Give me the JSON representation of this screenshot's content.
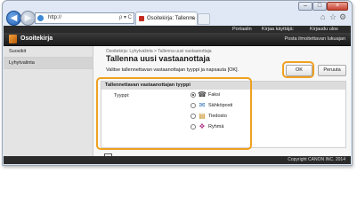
{
  "browser": {
    "url": "http://",
    "address_controls": "ρ ▾ C",
    "tab_title": "Osoitekirja: Tallenna ...",
    "tab_close": "×",
    "window_controls": {
      "minimize": "–",
      "maximize": "□",
      "close": "×"
    },
    "toolbar_icons": [
      "home-icon",
      "star-icon",
      "gear-icon"
    ]
  },
  "topbar": {
    "links": [
      "Portaalin",
      "Kirjaa käyttäjä:",
      "Kirjaudu ulos"
    ]
  },
  "header": {
    "app_title": "Osoitekirja",
    "right_link": "Posta ilmoitettavan lukuajan"
  },
  "sidebar": {
    "items": [
      {
        "label": "Suosikit"
      },
      {
        "label": "Lyhytvalinta"
      }
    ]
  },
  "main": {
    "breadcrumb": "Osoitekirja: Lyhytvalinta > Tallenna uusi vastaanottaja",
    "title": "Tallenna uusi vastaanottaja",
    "instruction": "Valitse tallennettavan vastaanottajan tyyppi ja napsauta [OK].",
    "ok_label": "OK",
    "cancel_label": "Peruuta",
    "panel_title": "Tallennettavan vastaanottajan tyyppi",
    "type_label": "Tyyppi:",
    "options": [
      {
        "label": "Faksi",
        "icon": "fax-icon",
        "checked": true
      },
      {
        "label": "Sähköposti",
        "icon": "email-icon",
        "checked": false
      },
      {
        "label": "Tiedosto",
        "icon": "file-icon",
        "checked": false
      },
      {
        "label": "Ryhmä",
        "icon": "group-icon",
        "checked": false
      }
    ]
  },
  "footer": {
    "copyright": "Copyright CANON INC. 2014"
  },
  "colors": {
    "highlight": "#f0a020",
    "header_bg": "#2b2b2b"
  }
}
